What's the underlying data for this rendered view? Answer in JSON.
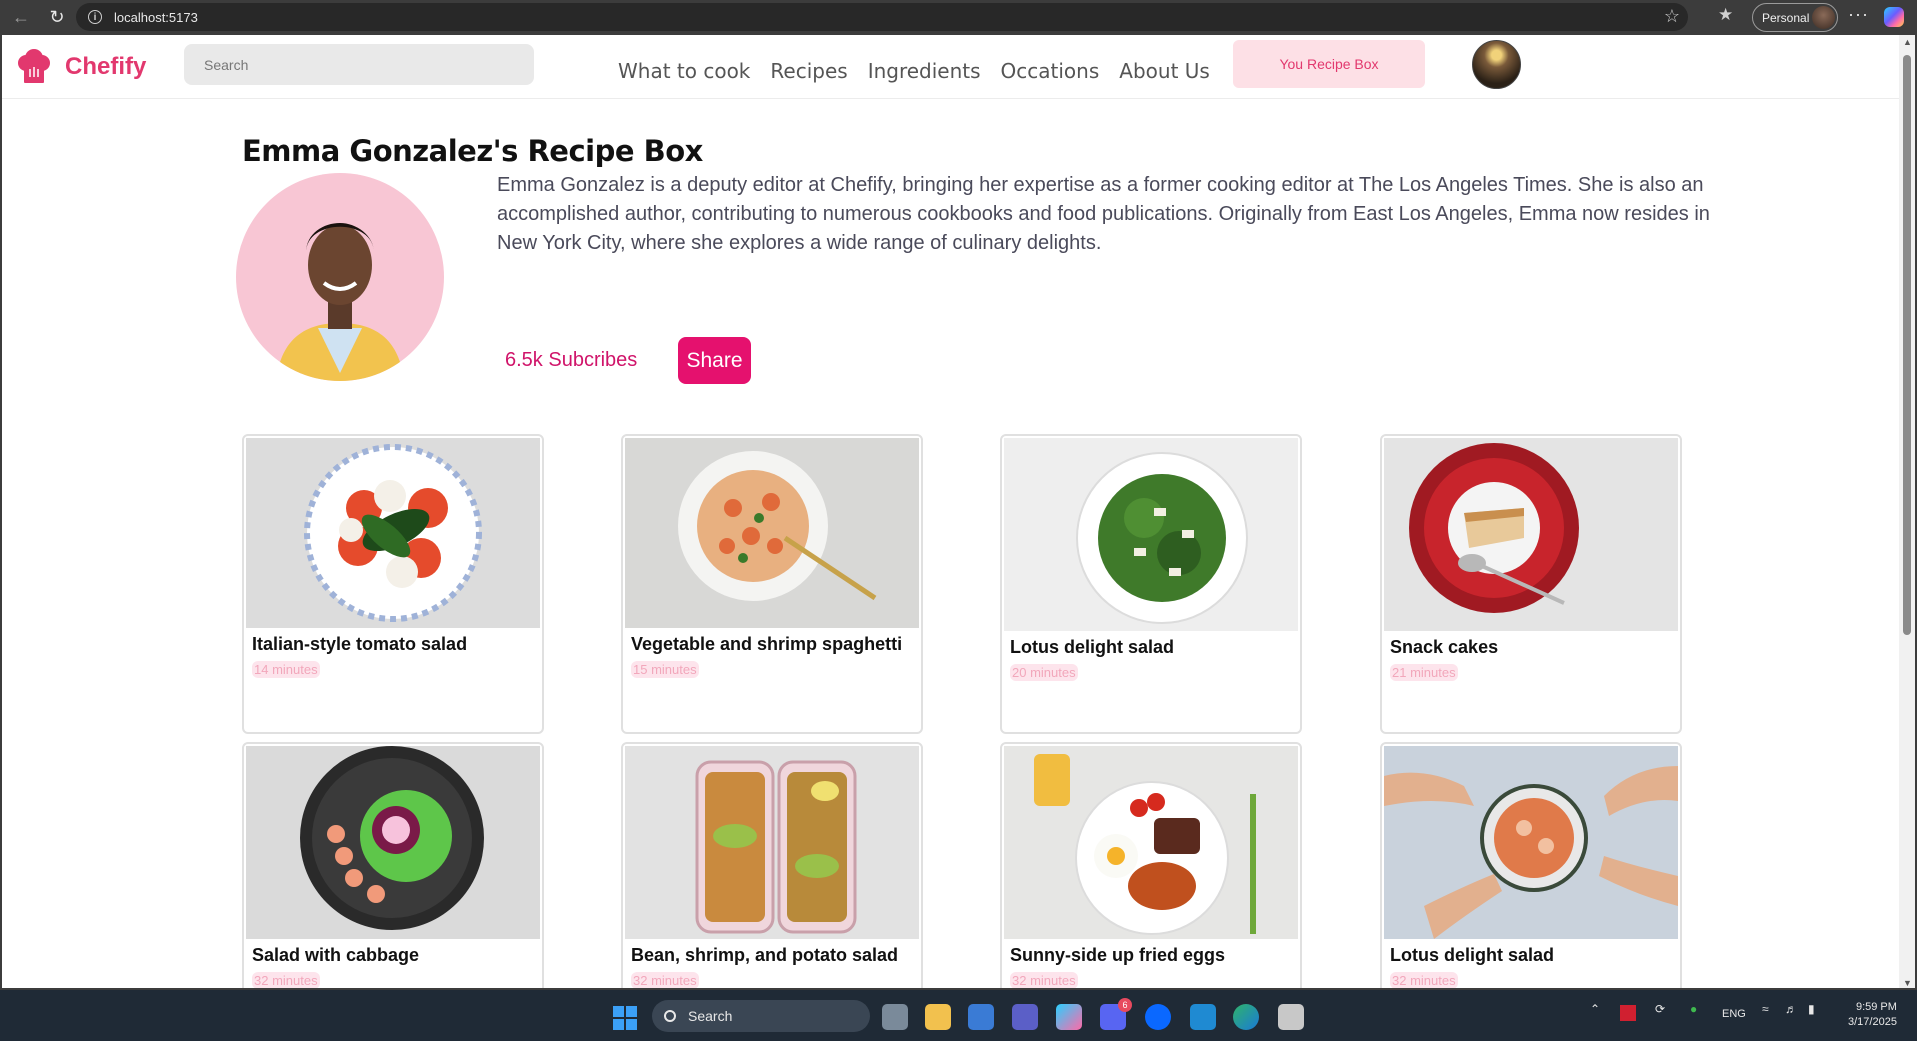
{
  "browser": {
    "url": "localhost:5173",
    "profile_label": "Personal"
  },
  "site": {
    "brand": "Chefify",
    "search_placeholder": "Search",
    "nav": [
      "What to cook",
      "Recipes",
      "Ingredients",
      "Occations",
      "About Us"
    ],
    "recipe_box_button": "You Recipe Box",
    "brand_color": "#e2386e"
  },
  "profile": {
    "title": "Emma Gonzalez's Recipe Box",
    "bio": "Emma Gonzalez is a deputy editor at Chefify, bringing her expertise as a former cooking editor at The Los Angeles Times. She is also an accomplished author, contributing to numerous cookbooks and food publications. Originally from East Los Angeles, Emma now resides in New York City, where she explores a wide range of culinary delights.",
    "subscribers": "6.5k Subcribes",
    "share_label": "Share"
  },
  "recipes": [
    {
      "title": "Italian-style tomato salad",
      "time": "14 minutes"
    },
    {
      "title": "Vegetable and shrimp spaghetti",
      "time": "15 minutes"
    },
    {
      "title": "Lotus delight salad",
      "time": "20 minutes"
    },
    {
      "title": "Snack cakes",
      "time": "21 minutes"
    },
    {
      "title": "Salad with cabbage",
      "time": "32 minutes"
    },
    {
      "title": "Bean, shrimp, and potato salad",
      "time": "32 minutes"
    },
    {
      "title": "Sunny-side up fried eggs",
      "time": "32 minutes"
    },
    {
      "title": "Lotus delight salad",
      "time": "32 minutes"
    }
  ],
  "taskbar": {
    "search_label": "Search",
    "language": "ENG",
    "time": "9:59 PM",
    "date": "3/17/2025",
    "discord_badge": "6"
  }
}
